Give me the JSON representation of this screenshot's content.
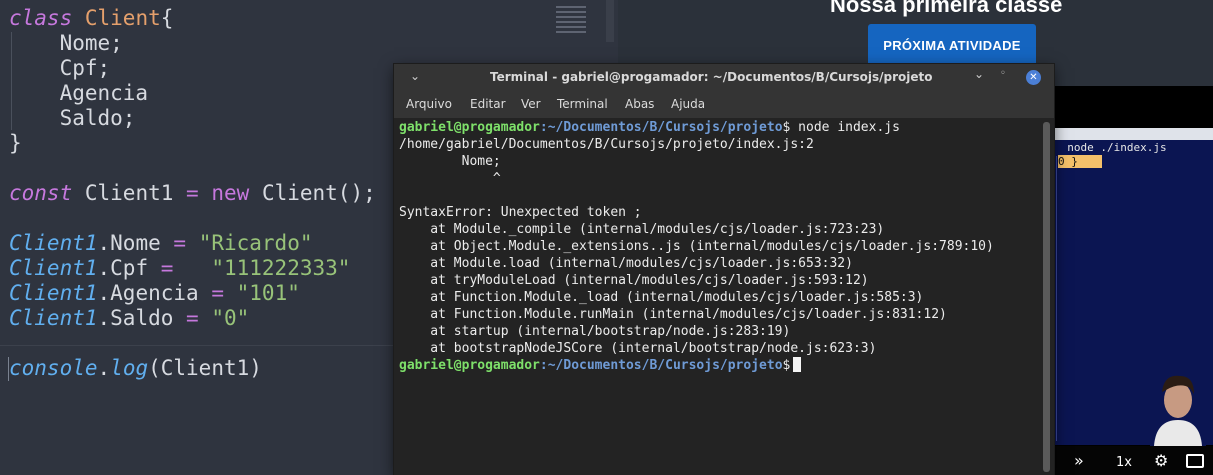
{
  "editor": {
    "lines": [
      {
        "t": "class",
        "v": "class"
      },
      {
        "t": "Client",
        "v": "Client"
      },
      {
        "t": "brace",
        "v": "{"
      },
      {
        "t": "field",
        "v": "Nome;"
      },
      {
        "t": "field",
        "v": "Cpf;"
      },
      {
        "t": "field",
        "v": "Agencia"
      },
      {
        "t": "field",
        "v": "Saldo;"
      }
    ],
    "kw_class": "class",
    "cls_name": "Client",
    "brace_open": "{",
    "field1": "Nome;",
    "field2": "Cpf;",
    "field3": "Agencia",
    "field4": "Saldo;",
    "brace_close": "}",
    "kw_const": "const",
    "var_name": "Client1",
    "eq": "=",
    "kw_new": "new",
    "ctor": "Client();",
    "obj": "Client1",
    "p1": ".Nome",
    "v1": "\"Ricardo\"",
    "p2": ".Cpf",
    "v2": "\"111222333\"",
    "p3": ".Agencia",
    "v3": "\"101\"",
    "p4": ".Saldo",
    "v4": "\"0\"",
    "console": "console",
    "dot": ".",
    "log": "log",
    "log_arg": "(Client1)"
  },
  "course": {
    "title": "Nossa primeira classe",
    "next_button": "PRÓXIMA ATIVIDADE",
    "video_cmd": "node ./index.js",
    "video_hl": "0 }",
    "speed": "1x",
    "icons": [
      "skip-forward-icon",
      "settings-icon",
      "pip-icon"
    ]
  },
  "terminal": {
    "title": "Terminal - gabriel@progamador: ~/Documentos/B/Cursojs/projeto",
    "menu": [
      "Arquivo",
      "Editar",
      "Ver",
      "Terminal",
      "Abas",
      "Ajuda"
    ],
    "prompt_user": "gabriel@progamador",
    "prompt_path": ":~/Documentos/B/Cursojs/projeto",
    "command": "$ node index.js",
    "out": [
      "/home/gabriel/Documentos/B/Cursojs/projeto/index.js:2",
      "        Nome;",
      "            ^",
      "",
      "SyntaxError: Unexpected token ;",
      "    at Module._compile (internal/modules/cjs/loader.js:723:23)",
      "    at Object.Module._extensions..js (internal/modules/cjs/loader.js:789:10)",
      "    at Module.load (internal/modules/cjs/loader.js:653:32)",
      "    at tryModuleLoad (internal/modules/cjs/loader.js:593:12)",
      "    at Function.Module._load (internal/modules/cjs/loader.js:585:3)",
      "    at Function.Module.runMain (internal/modules/cjs/loader.js:831:12)",
      "    at startup (internal/bootstrap/node.js:283:19)",
      "    at bootstrapNodeJSCore (internal/bootstrap/node.js:623:3)"
    ],
    "prompt_end": "$"
  }
}
